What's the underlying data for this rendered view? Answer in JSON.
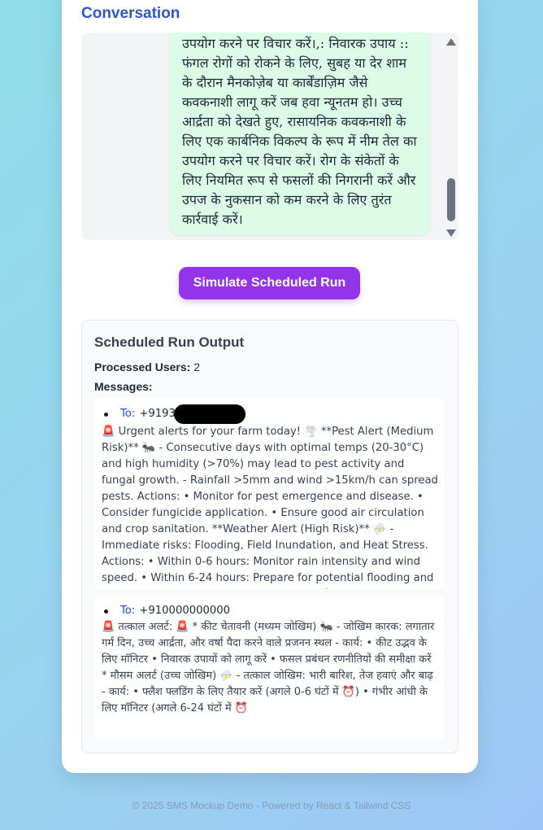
{
  "conversation": {
    "title": "Conversation",
    "reply_text": "उपयोग करने पर विचार करें।,: निवारक उपाय :: फंगल रोगों को रोकने के लिए, सुबह या देर शाम के दौरान मैनकोज़ेब या कार्बेंडाज़िम जैसे कवकनाशी लागू करें जब हवा न्यूनतम हो। उच्च आर्द्रता को देखते हुए, रासायनिक कवकनाशी के लिए एक कार्बनिक विकल्प के रूप में नीम तेल का उपयोग करने पर विचार करें। रोग के संकेतों के लिए नियमित रूप से फसलों की निगरानी करें और उपज के नुकसान को कम करने के लिए तुरंत कार्रवाई करें।"
  },
  "simulate_button_label": "Simulate Scheduled Run",
  "output": {
    "title": "Scheduled Run Output",
    "processed_label": "Processed Users:",
    "processed_count": "2",
    "messages_label": "Messages:",
    "to_label": "To:",
    "messages": [
      {
        "to": "+9193",
        "body": "🚨 Urgent alerts for your farm today! 🌪️ **Pest Alert (Medium Risk)** 🐜 - Consecutive days with optimal temps (20-30°C) and high humidity (>70%) may lead to pest activity and fungal growth. - Rainfall >5mm and wind >15km/h can spread pests. Actions: • Monitor for pest emergence and disease. • Consider fungicide application. • Ensure good air circulation and crop sanitation. **Weather Alert (High Risk)** ⛈️ - Immediate risks: Flooding, Field Inundation, and Heat Stress. Actions: • Within 0-6 hours: Monitor rain intensity and wind speed. • Within 6-24 hours: Prepare for potential flooding and crop lodging. Stay safe and take action! ☀️"
      },
      {
        "to": "+910000000000",
        "body": "🚨 तत्काल अलर्ट: 🚨 * कीट चेतावनी (मध्यम जोखिम) 🐜 - जोखिम कारक: लगातार गर्म दिन, उच्च आर्द्रता, और वर्षा पैदा करने वाले प्रजनन स्थल - कार्य: • कीट उद्भव के लिए मॉनिटर • निवारक उपायों को लागू करें • फसल प्रबंधन रणनीतियों की समीक्षा करें * मौसम अलर्ट (उच्च जोखिम) ⛈️ - तत्काल जोखिम: भारी बारिश, तेज हवाएं और बाढ़ - कार्य: • फ्लैश फ्लडिंग के लिए तैयार करें (अगले 0-6 घंटों में ⏰) • गंभीर आंधी के लिए मॉनिटर (अगले 6-24 घंटों में ⏰"
      }
    ]
  },
  "footer": "© 2025 SMS Mockup Demo - Powered by React & Tailwind CSS",
  "colors": {
    "accent_purple": "#9333ea",
    "title_blue": "#2f56c9",
    "bubble_green": "#dcfce7",
    "to_blue": "#1d4ed8"
  },
  "icons": [
    "scroll-up-arrow-icon",
    "scroll-down-arrow-icon",
    "redaction-mark"
  ]
}
